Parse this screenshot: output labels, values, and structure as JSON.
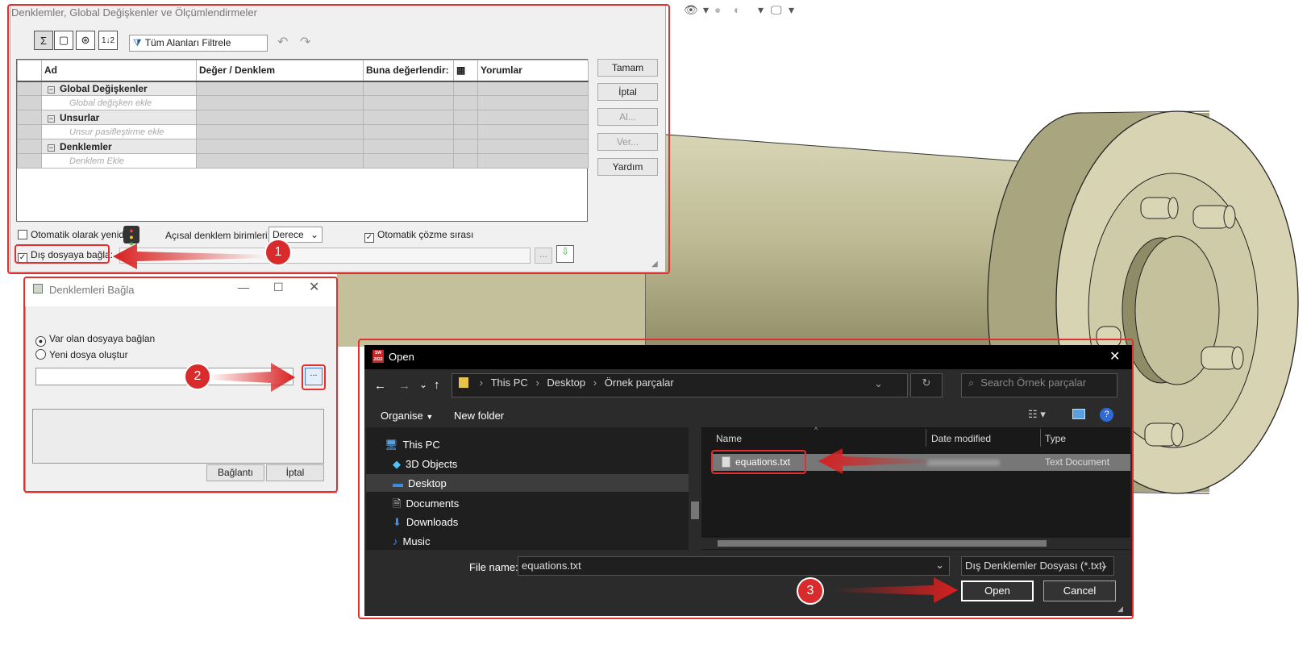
{
  "eq_dialog": {
    "title": "Denklemler, Global Değişkenler ve Ölçümlendirmeler",
    "filter": "Tüm Alanları Filtrele",
    "columns": [
      "Ad",
      "Değer / Denklem",
      "Buna değerlendir:",
      "Yorumlar"
    ],
    "sections": [
      {
        "name": "Global Değişkenler",
        "placeholder": "Global değişken ekle"
      },
      {
        "name": "Unsurlar",
        "placeholder": "Unsur pasifleştirme ekle"
      },
      {
        "name": "Denklemler",
        "placeholder": "Denklem Ekle"
      }
    ],
    "buttons": {
      "ok": "Tamam",
      "cancel": "İptal",
      "import": "Al...",
      "export": "Ver...",
      "help": "Yardım"
    },
    "auto_rebuild": "Otomatik olarak yenid",
    "angle_units_label": "Açısal denklem birimleri:",
    "angle_units_value": "Derece",
    "auto_solve": "Otomatik çözme sırası",
    "link_external": "Dış dosyaya bağla:",
    "browse": "..."
  },
  "link_dialog": {
    "title": "Denklemleri Bağla",
    "opt_existing": "Var olan dosyaya bağlan",
    "opt_new": "Yeni dosya oluştur",
    "browse": "...",
    "link_btn": "Bağlantı",
    "cancel_btn": "İptal"
  },
  "open_dialog": {
    "app_badge": "SW 2022",
    "title": "Open",
    "path": [
      "This PC",
      "Desktop",
      "Örnek parçalar"
    ],
    "search_placeholder": "Search Örnek parçalar",
    "organise": "Organise",
    "new_folder": "New folder",
    "nav": [
      "This PC",
      "3D Objects",
      "Desktop",
      "Documents",
      "Downloads",
      "Music"
    ],
    "columns": [
      "Name",
      "Date modified",
      "Type"
    ],
    "file": {
      "name": "equations.txt",
      "type": "Text Document"
    },
    "file_name_label": "File name:",
    "file_name_value": "equations.txt",
    "file_type": "Dış Denklemler Dosyası (*.txt)",
    "open_btn": "Open",
    "cancel_btn": "Cancel"
  },
  "steps": [
    "1",
    "2",
    "3"
  ]
}
